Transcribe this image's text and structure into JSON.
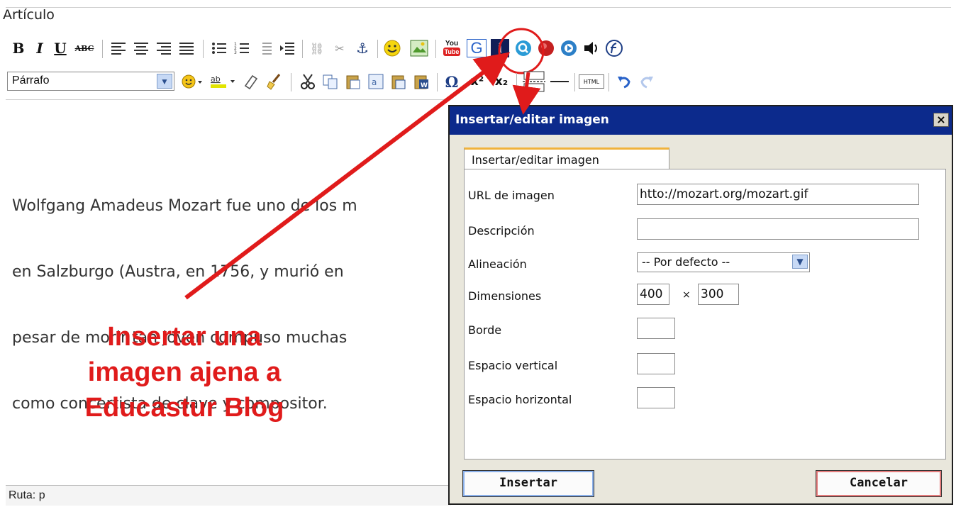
{
  "editor": {
    "title": "Artículo",
    "toolbar1": {
      "bold": "B",
      "italic": "I",
      "underline": "U",
      "strike": "ABC",
      "youtube_top": "You",
      "youtube_bottom": "Tube",
      "g_button": "G",
      "i_button": "i"
    },
    "toolbar2": {
      "format_value": "Párrafo",
      "html_label": "HTML",
      "omega": "Ω",
      "superscript": "x²",
      "subscript": "x₂"
    },
    "paragraph_lines": [
      "Wolfgang Amadeus Mozart fue uno de los m",
      "en Salzburgo (Austra, en 1756, y murió en",
      "pesar de morir tan joven compuso muchas",
      "como concertista de clave y compositor."
    ],
    "status_label": "Ruta: p"
  },
  "annotation": {
    "lines": [
      "Insertar una",
      "imagen ajena a",
      "Educastur Blog"
    ],
    "color": "#e01b1b"
  },
  "dialog": {
    "title": "Insertar/editar imagen",
    "close": "×",
    "tab_label": "Insertar/editar imagen",
    "fields": {
      "url_label": "URL de imagen",
      "url_value": "htto://mozart.org/mozart.gif",
      "desc_label": "Descripción",
      "desc_value": "",
      "align_label": "Alineación",
      "align_value": "-- Por defecto --",
      "dims_label": "Dimensiones",
      "width_value": "400",
      "times": "×",
      "height_value": "300",
      "border_label": "Borde",
      "border_value": "",
      "vspace_label": "Espacio vertical",
      "vspace_value": "",
      "hspace_label": "Espacio horizontal",
      "hspace_value": ""
    },
    "insert_button": "Insertar",
    "cancel_button": "Cancelar"
  },
  "colors": {
    "dialog_titlebar": "#0c2a8c",
    "arrow": "#e01b1b",
    "tab_accent": "#f0b33c"
  }
}
